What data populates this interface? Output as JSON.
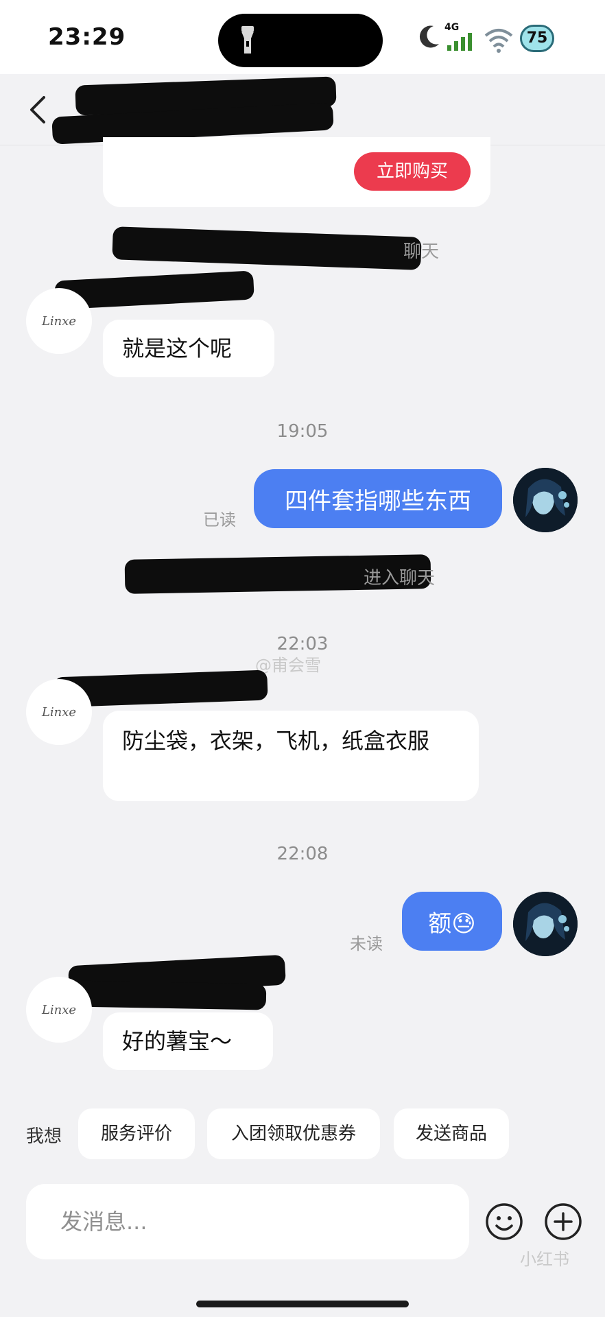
{
  "status_bar": {
    "time": "23:29",
    "network": "4G",
    "battery": "75"
  },
  "icons": {
    "back": "chevron-left-icon",
    "flashlight": "flashlight-icon",
    "moon": "moon-icon",
    "signal": "signal-icon",
    "wifi": "wifi-icon",
    "emoji": "smiley-icon",
    "plus": "plus-icon"
  },
  "product_card": {
    "buy_label": "立即购买"
  },
  "chat": {
    "system_notice_1_suffix": "聊天",
    "system_notice_2_fragment": "进入聊天",
    "messages": [
      {
        "side": "left",
        "text": "就是这个呢"
      },
      {
        "timestamp": "19:05"
      },
      {
        "side": "right",
        "text": "四件套指哪些东西",
        "status": "已读"
      },
      {
        "timestamp": "22:03"
      },
      {
        "side": "left",
        "text": "防尘袋，衣架，飞机，纸盒衣服"
      },
      {
        "timestamp": "22:08"
      },
      {
        "side": "right",
        "text": "额😓",
        "status": "未读"
      },
      {
        "side": "left",
        "text": "好的薯宝～"
      }
    ],
    "left_avatar_text": "Linxe",
    "watermark_center": "@甫会雪"
  },
  "quick_actions": {
    "label": "我想",
    "chips": [
      "服务评价",
      "入团领取优惠券",
      "发送商品"
    ]
  },
  "composer": {
    "placeholder": "发消息..."
  },
  "watermark": "小红书",
  "colors": {
    "accent_blue": "#4c7ff2",
    "buy_red": "#ec3b4e",
    "background": "#f2f2f4"
  }
}
